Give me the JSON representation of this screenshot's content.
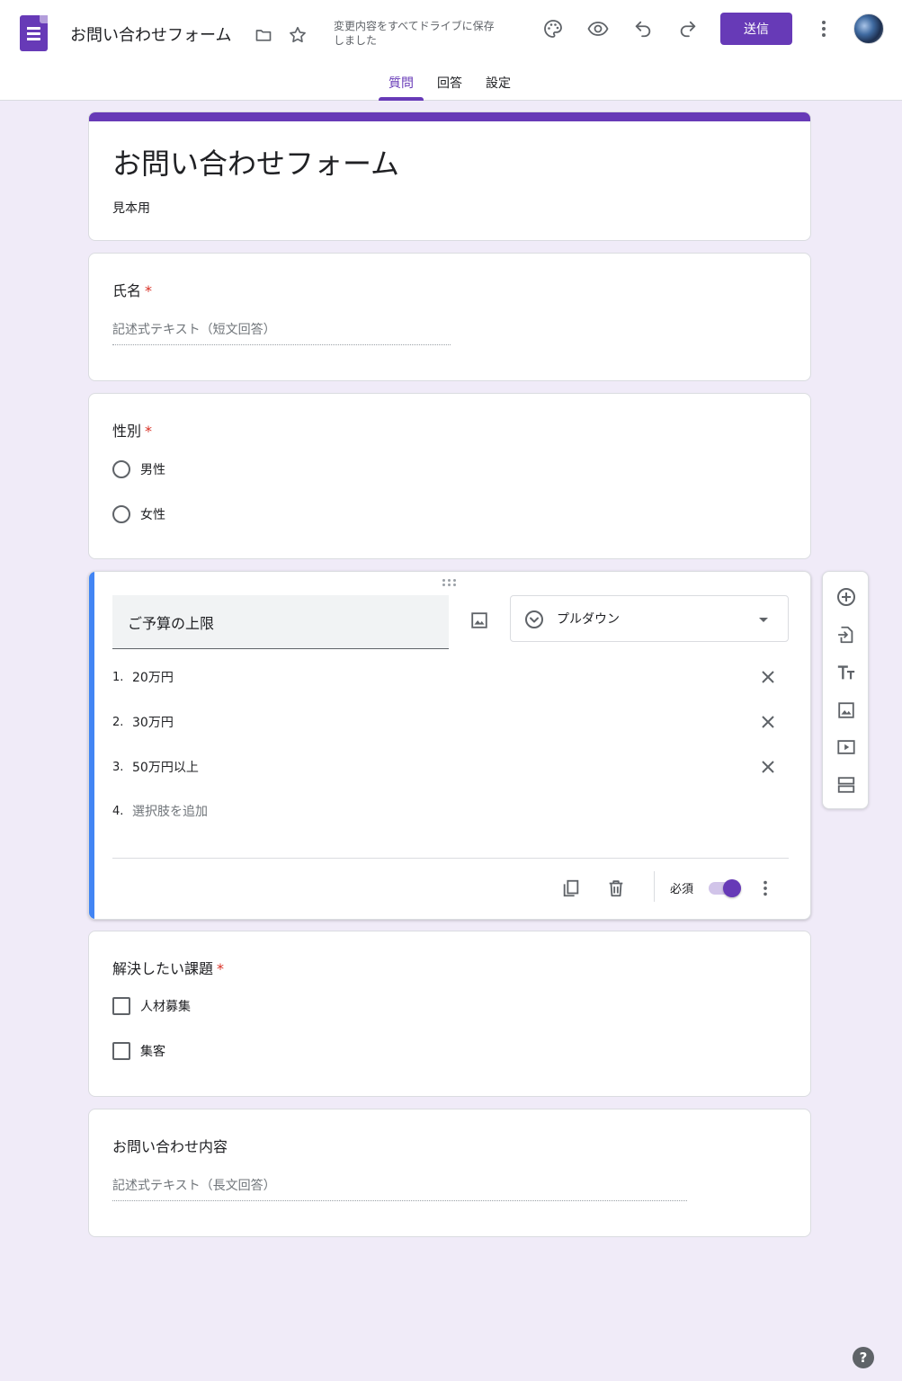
{
  "header": {
    "doc_title": "お問い合わせフォーム",
    "save_status": "変更内容をすべてドライブに保存しました",
    "send_label": "送信"
  },
  "tabs": [
    {
      "label": "質問",
      "active": true
    },
    {
      "label": "回答",
      "active": false
    },
    {
      "label": "設定",
      "active": false
    }
  ],
  "form": {
    "title": "お問い合わせフォーム",
    "description": "見本用"
  },
  "questions": {
    "name": {
      "title": "氏名",
      "required_mark": "*",
      "placeholder": "記述式テキスト（短文回答）"
    },
    "gender": {
      "title": "性別",
      "required_mark": "*",
      "options": [
        "男性",
        "女性"
      ]
    },
    "budget": {
      "title": "ご予算の上限",
      "type_label": "プルダウン",
      "options": [
        {
          "num": "1.",
          "label": "20万円"
        },
        {
          "num": "2.",
          "label": "30万円"
        },
        {
          "num": "3.",
          "label": "50万円以上"
        }
      ],
      "add_option": {
        "num": "4.",
        "label": "選択肢を追加"
      },
      "required_label": "必須",
      "required_on": true
    },
    "issues": {
      "title": "解決したい課題",
      "required_mark": "*",
      "options": [
        "人材募集",
        "集客"
      ]
    },
    "inquiry": {
      "title": "お問い合わせ内容",
      "placeholder": "記述式テキスト（長文回答）"
    }
  },
  "help_label": "?",
  "colors": {
    "accent": "#673ab7",
    "active_bar": "#4285f4",
    "background": "#f0ebf8",
    "required": "#d93025"
  }
}
